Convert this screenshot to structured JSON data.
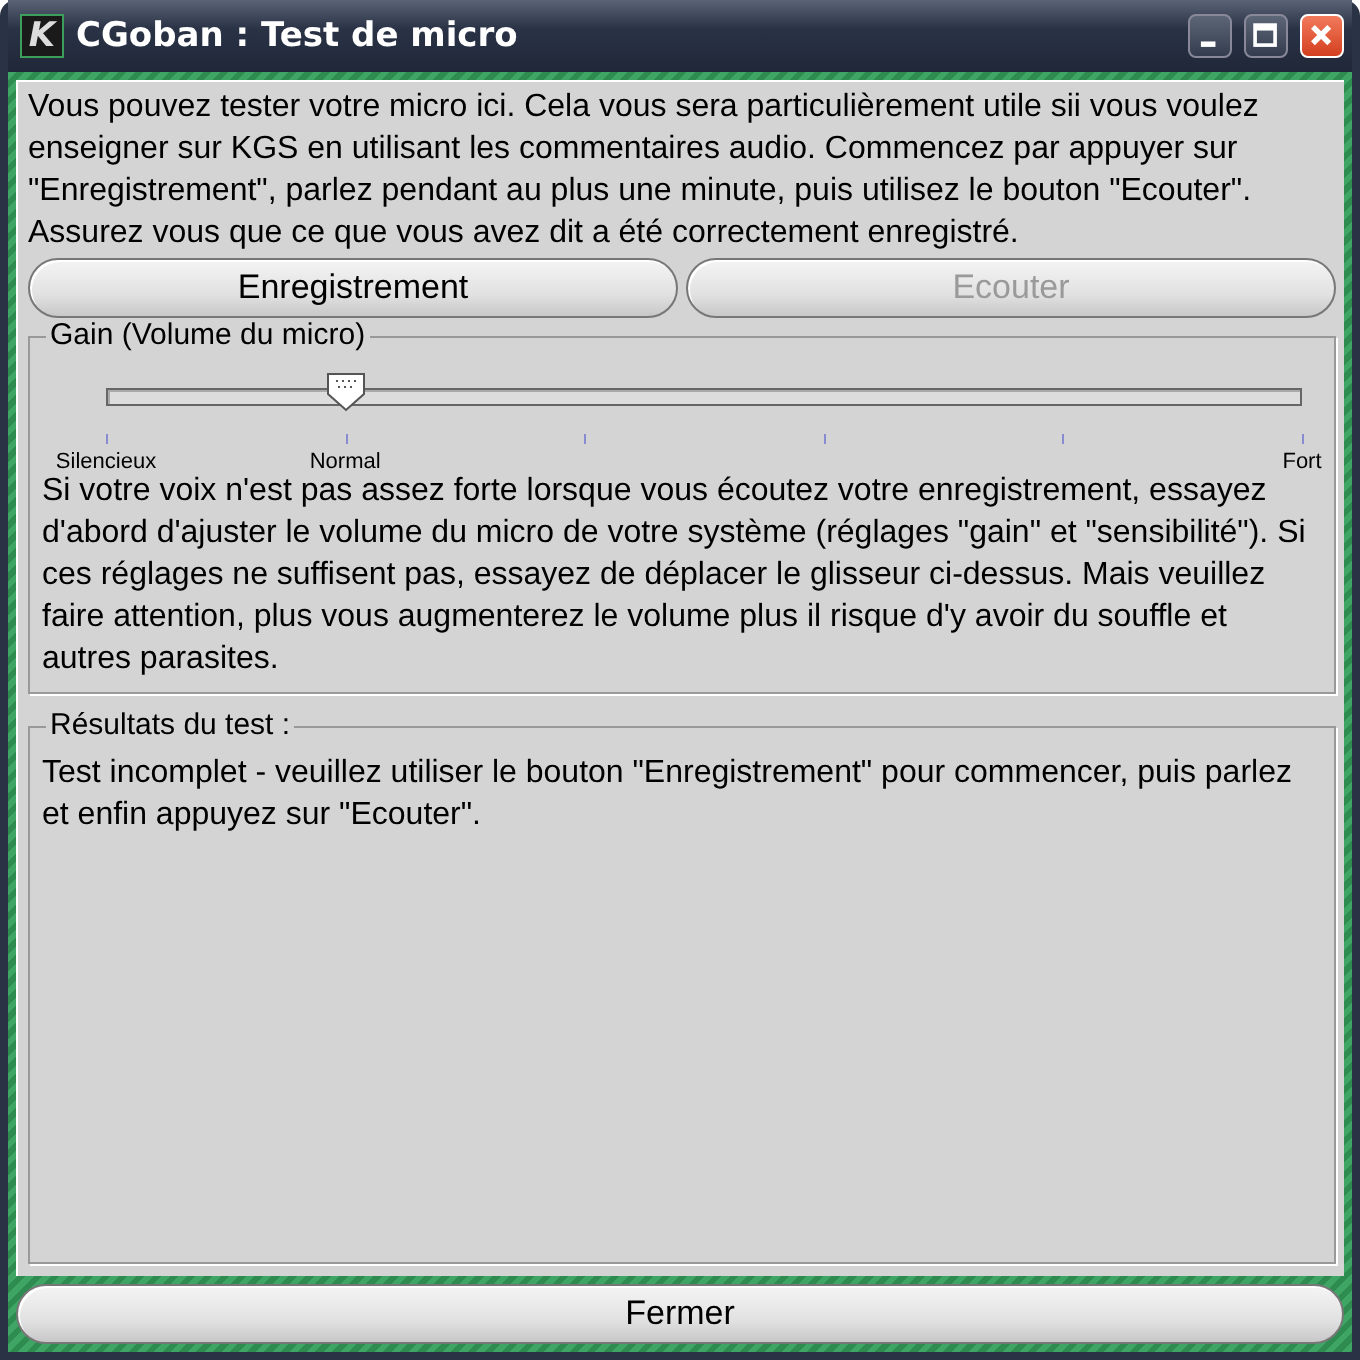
{
  "window": {
    "title": "CGoban : Test de micro",
    "logo": "K"
  },
  "intro": "Vous pouvez tester votre micro ici. Cela vous sera particulièrement utile sii vous voulez enseigner sur KGS en utilisant les commentaires audio. Commencez par appuyer sur \"Enregistrement\", parlez pendant au plus une minute, puis utilisez le bouton \"Ecouter\". Assurez vous que ce que vous avez dit a été correctement enregistré.",
  "buttons": [
    {
      "label": "Enregistrement",
      "disabled": false
    },
    {
      "label": "Ecouter",
      "disabled": true
    }
  ],
  "gain": {
    "title": "Gain (Volume du micro)",
    "level": 0.2,
    "labels": [
      {
        "text": "Silencieux",
        "kind": "min"
      },
      {
        "text": "Normal",
        "kind": "normal"
      },
      {
        "text": "Fort",
        "kind": "max"
      }
    ],
    "help": "Si votre voix n'est pas assez forte lorsque vous écoutez votre enregistrement, essayez d'abord d'ajuster le volume du micro de votre système (réglages \"gain\" et \"sensibilité\"). Si ces réglages ne suffisent pas, essayez de déplacer le glisseur ci-dessus. Mais veuillez faire attention, plus vous augmenterez le volume plus il risque d'y avoir du souffle et autres parasites."
  },
  "results": {
    "title": "Résultats du test :",
    "text": "Test incomplet - veuillez utiliser le bouton \"Enregistrement\" pour commencer, puis parlez et enfin appuyez sur \"Ecouter\"."
  },
  "close_button": {
    "label": "Fermer",
    "disabled": false
  }
}
